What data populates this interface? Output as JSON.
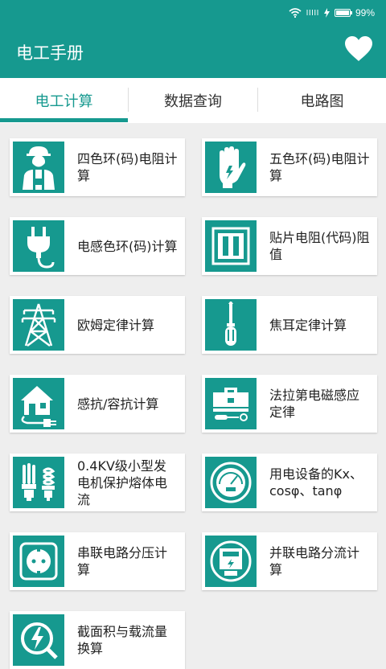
{
  "status_bar": {
    "signal": "IIIII",
    "battery_text": "99%",
    "battery_level": 0.99
  },
  "app": {
    "title": "电工手册"
  },
  "tabs": [
    {
      "label": "电工计算",
      "active": true
    },
    {
      "label": "数据查询",
      "active": false
    },
    {
      "label": "电路图",
      "active": false
    }
  ],
  "colors": {
    "primary": "#16998f",
    "background": "#eeeeee",
    "card": "#ffffff"
  },
  "items": [
    {
      "label": "四色环(码)电阻计算",
      "icon": "worker-icon"
    },
    {
      "label": "五色环(码)电阻计算",
      "icon": "glove-icon"
    },
    {
      "label": "电感色环(码)计算",
      "icon": "plug-icon"
    },
    {
      "label": "贴片电阻(代码)阻值",
      "icon": "smd-resistor-icon"
    },
    {
      "label": "欧姆定律计算",
      "icon": "pylon-icon"
    },
    {
      "label": "焦耳定律计算",
      "icon": "screwdriver-icon"
    },
    {
      "label": "感抗/容抗计算",
      "icon": "house-plug-icon"
    },
    {
      "label": "法拉第电磁感应定律",
      "icon": "toolbox-icon"
    },
    {
      "label": "0.4KV级小型发电机保护熔体电流",
      "icon": "bulbs-icon"
    },
    {
      "label": "用电设备的Kx、cosφ、tanφ",
      "icon": "gauge-icon"
    },
    {
      "label": "串联电路分压计算",
      "icon": "socket-icon"
    },
    {
      "label": "并联电路分流计算",
      "icon": "meter-icon"
    },
    {
      "label": "截面积与载流量换算",
      "icon": "bolt-circle-icon"
    }
  ]
}
